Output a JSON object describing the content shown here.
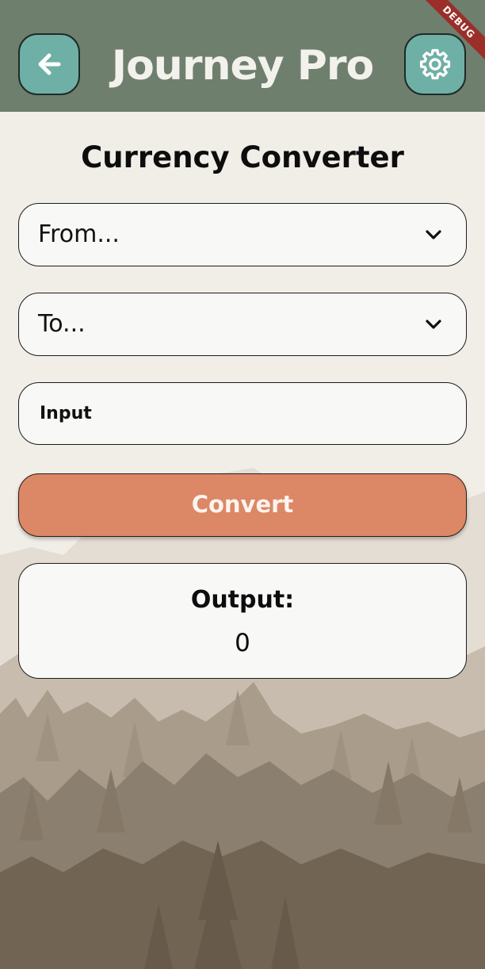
{
  "app": {
    "title": "Journey Pro",
    "debug_banner": "DEBUG"
  },
  "header": {
    "back_icon": "arrow-left-icon",
    "settings_icon": "gear-icon",
    "background_color": "#6f7f6d",
    "icon_button_color": "#6fb0a6"
  },
  "converter": {
    "title": "Currency Converter",
    "from_dropdown": {
      "placeholder": "From...",
      "icon": "chevron-down-icon"
    },
    "to_dropdown": {
      "placeholder": "To...",
      "icon": "chevron-down-icon"
    },
    "amount_input": {
      "placeholder": "Input",
      "value": ""
    },
    "convert_button": {
      "label": "Convert",
      "color": "#dc8766"
    },
    "output": {
      "label": "Output:",
      "value": "0"
    }
  },
  "background": {
    "description_icon": "forest-silhouette",
    "colors": [
      "#f1eee8",
      "#c8bcae",
      "#a89a89",
      "#8b7f6f",
      "#6e6253"
    ]
  }
}
